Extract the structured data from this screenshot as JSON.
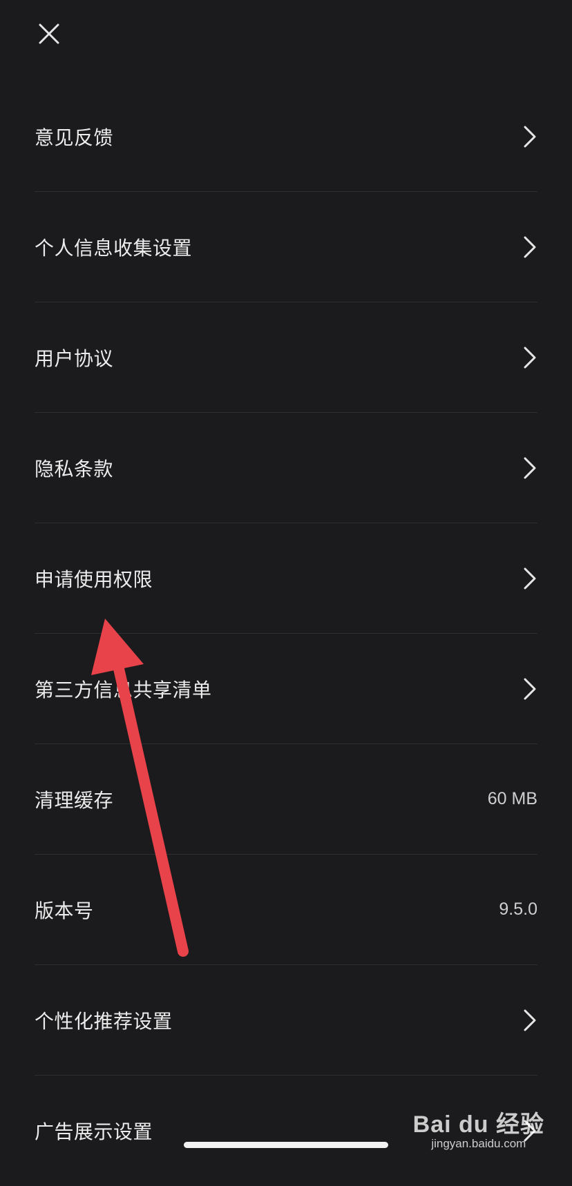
{
  "header": {
    "close_icon": "close-icon"
  },
  "settings": [
    {
      "label": "意见反馈",
      "value": "",
      "has_chevron": true
    },
    {
      "label": "个人信息收集设置",
      "value": "",
      "has_chevron": true
    },
    {
      "label": "用户协议",
      "value": "",
      "has_chevron": true
    },
    {
      "label": "隐私条款",
      "value": "",
      "has_chevron": true
    },
    {
      "label": "申请使用权限",
      "value": "",
      "has_chevron": true
    },
    {
      "label": "第三方信息共享清单",
      "value": "",
      "has_chevron": true
    },
    {
      "label": "清理缓存",
      "value": "60 MB",
      "has_chevron": false
    },
    {
      "label": "版本号",
      "value": "9.5.0",
      "has_chevron": false
    },
    {
      "label": "个性化推荐设置",
      "value": "",
      "has_chevron": true
    },
    {
      "label": "广告展示设置",
      "value": "",
      "has_chevron": true
    }
  ],
  "watermark": {
    "logo": "Bai du 经验",
    "url": "jingyan.baidu.com"
  },
  "colors": {
    "background": "#1b1a1c",
    "text": "#ececec",
    "divider": "#2f2e31",
    "annotation_arrow": "#e8434a"
  }
}
